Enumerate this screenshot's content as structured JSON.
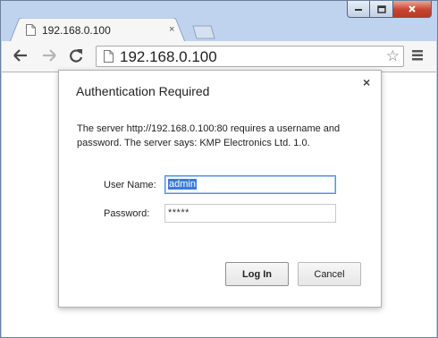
{
  "window": {
    "controls": {
      "minimize": "minimize-icon",
      "maximize": "maximize-icon",
      "close": "close-icon"
    }
  },
  "tab": {
    "title": "192.168.0.100",
    "close_glyph": "×",
    "favicon": "page-icon"
  },
  "toolbar": {
    "back": "back-arrow-icon",
    "forward": "forward-arrow-icon",
    "reload": "reload-icon",
    "url": "192.168.0.100",
    "star_glyph": "☆",
    "menu": "hamburger-menu-icon"
  },
  "dialog": {
    "title": "Authentication Required",
    "close_glyph": "×",
    "message": "The server http://192.168.0.100:80 requires a username and password. The server says: KMP Electronics Ltd. 1.0.",
    "username_label": "User Name:",
    "username_value": "admin",
    "password_label": "Password:",
    "password_value": "*****",
    "login_label": "Log In",
    "cancel_label": "Cancel"
  },
  "colors": {
    "frame": "#bfd3ee",
    "focus_border": "#4d90fe",
    "selection": "#3d79d6",
    "close_button": "#c6452f"
  }
}
